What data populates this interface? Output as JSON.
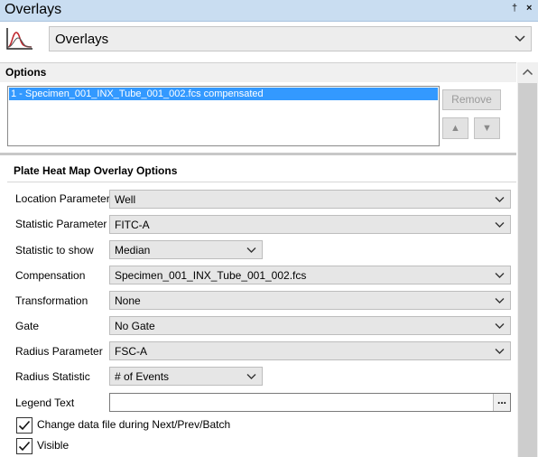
{
  "window": {
    "title": "Overlays",
    "pin_glyph": "†",
    "close_glyph": "×"
  },
  "overlay_selector": {
    "icon": "histogram-overlay-icon",
    "value": "Overlays"
  },
  "options": {
    "header": "Options",
    "list_items": [
      "1 - Specimen_001_INX_Tube_001_002.fcs compensated"
    ],
    "remove_label": "Remove",
    "up_glyph": "▲",
    "down_glyph": "▼"
  },
  "heatmap": {
    "section_title": "Plate Heat Map Overlay Options",
    "location_parameter": {
      "label": "Location Parameter",
      "value": "Well"
    },
    "statistic_parameter": {
      "label": "Statistic Parameter",
      "value": "FITC-A"
    },
    "statistic_to_show": {
      "label": "Statistic to show",
      "value": "Median"
    },
    "compensation": {
      "label": "Compensation",
      "value": "Specimen_001_INX_Tube_001_002.fcs"
    },
    "transformation": {
      "label": "Transformation",
      "value": "None"
    },
    "gate": {
      "label": "Gate",
      "value": "No Gate"
    },
    "radius_parameter": {
      "label": "Radius Parameter",
      "value": "FSC-A"
    },
    "radius_statistic": {
      "label": "Radius Statistic",
      "value": "# of Events"
    },
    "legend_text": {
      "label": "Legend Text",
      "value": "",
      "button": "..."
    },
    "change_data_file": {
      "label": "Change data file during Next/Prev/Batch",
      "checked": true
    },
    "visible": {
      "label": "Visible",
      "checked": true
    }
  },
  "colors": {
    "titlebar": "#c9ddf1",
    "selection": "#3399ff",
    "icon_red": "#c0262d"
  }
}
